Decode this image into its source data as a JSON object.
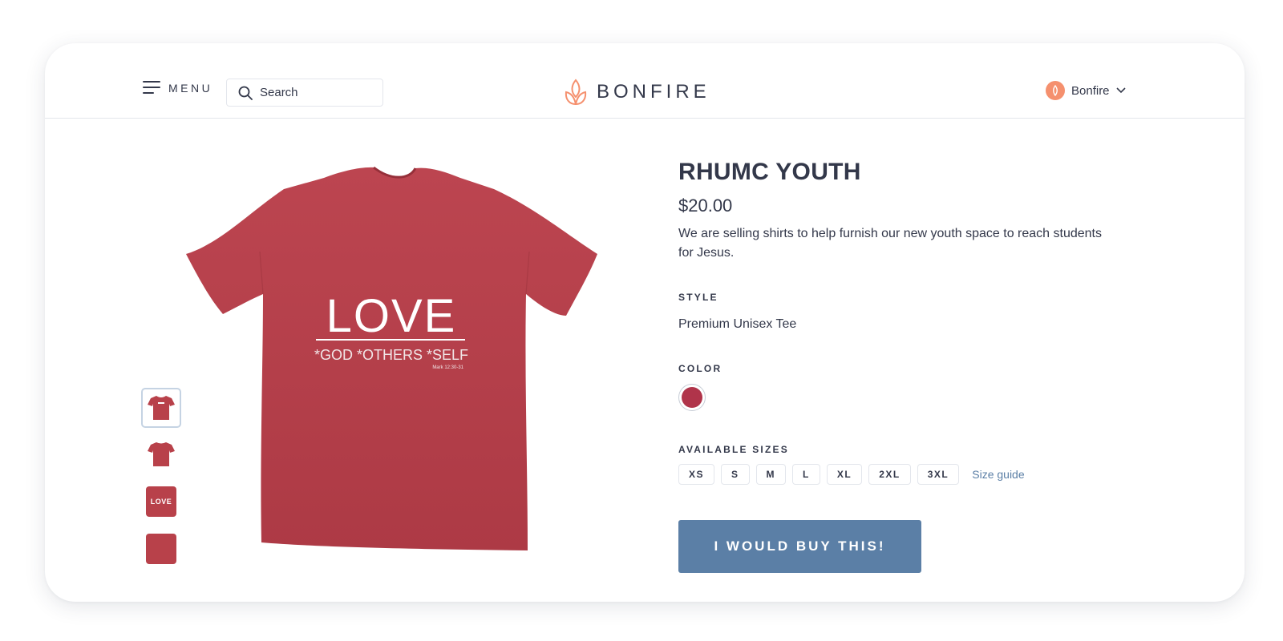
{
  "header": {
    "menu_label": "MENU",
    "search_placeholder": "Search",
    "logo_text": "BONFIRE",
    "account_name": "Bonfire"
  },
  "product": {
    "title": "RHUMC YOUTH",
    "price": "$20.00",
    "description": "We are selling shirts to help furnish our new youth space to reach students for Jesus.",
    "style_label": "STYLE",
    "style_value": "Premium Unisex Tee",
    "color_label": "COLOR",
    "selected_color": "#b0344a",
    "sizes_label": "AVAILABLE SIZES",
    "sizes": [
      "XS",
      "S",
      "M",
      "L",
      "XL",
      "2XL",
      "3XL"
    ],
    "size_guide_label": "Size guide",
    "buy_label": "I WOULD BUY THIS!"
  },
  "shirt_print": {
    "headline": "LOVE",
    "subline": "*GOD *OTHERS *SELF",
    "reference": "Mark 12:30-31",
    "thumb_text": "LOVE"
  },
  "colors": {
    "accent": "#5b7fa6",
    "shirt": "#b8414a",
    "brand": "#f5906e",
    "text": "#33384a"
  }
}
